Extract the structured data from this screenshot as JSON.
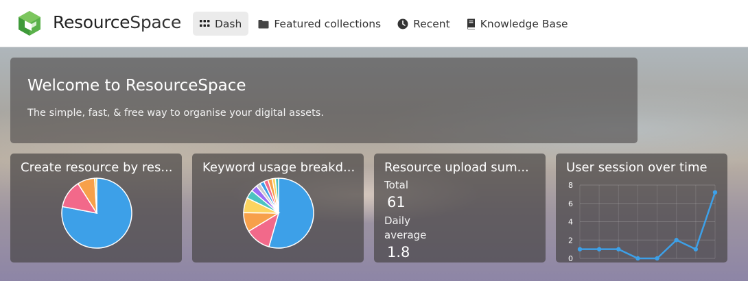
{
  "header": {
    "brand_bold": "Resource",
    "brand_light": "Space",
    "nav": [
      {
        "label": "Dash",
        "icon": "grid-icon",
        "active": true
      },
      {
        "label": "Featured collections",
        "icon": "folder-icon",
        "active": false
      },
      {
        "label": "Recent",
        "icon": "clock-icon",
        "active": false
      },
      {
        "label": "Knowledge Base",
        "icon": "book-icon",
        "active": false
      }
    ]
  },
  "welcome": {
    "title": "Welcome to ResourceSpace",
    "subtitle": "The simple, fast, & free way to organise your digital assets."
  },
  "tiles": [
    {
      "title": "Create resource by res..."
    },
    {
      "title": "Keyword usage breakd..."
    },
    {
      "title": "Resource upload sum...",
      "total_label": "Total",
      "total_value": "61",
      "daily_label_1": "Daily",
      "daily_label_2": "average",
      "daily_value": "1.8"
    },
    {
      "title": "User session over time"
    }
  ],
  "colors": {
    "accent_blue": "#3da0e8",
    "pink": "#f2698a",
    "orange": "#f7a04a",
    "yellow": "#fcd460",
    "teal": "#4cc3c0",
    "purple": "#9b6cf5",
    "grey": "#c9cbcf",
    "logo_green": "#5ab14a"
  },
  "chart_data": [
    {
      "type": "pie",
      "values": [
        78,
        13,
        8,
        1
      ],
      "colors": [
        "#3da0e8",
        "#f2698a",
        "#f7a04a",
        "#fcd460"
      ]
    },
    {
      "type": "pie",
      "values": [
        55,
        12,
        9,
        7,
        4,
        3,
        2,
        2,
        2,
        2,
        1.5,
        1.5
      ],
      "colors": [
        "#3da0e8",
        "#f2698a",
        "#f7a04a",
        "#fcd460",
        "#4cc3c0",
        "#9b6cf5",
        "#c9cbcf",
        "#3da0e8",
        "#f2698a",
        "#f7a04a",
        "#fcd460",
        "#4cc3c0"
      ]
    },
    {
      "type": "line",
      "x": [
        1,
        2,
        3,
        4,
        5,
        6,
        7,
        8
      ],
      "series": [
        {
          "values": [
            1,
            1,
            1,
            0,
            0,
            2,
            1,
            7.2
          ]
        }
      ],
      "ylim": [
        0,
        8
      ],
      "yticks": [
        "8",
        "6",
        "4",
        "2",
        "0"
      ],
      "grid": true
    }
  ]
}
